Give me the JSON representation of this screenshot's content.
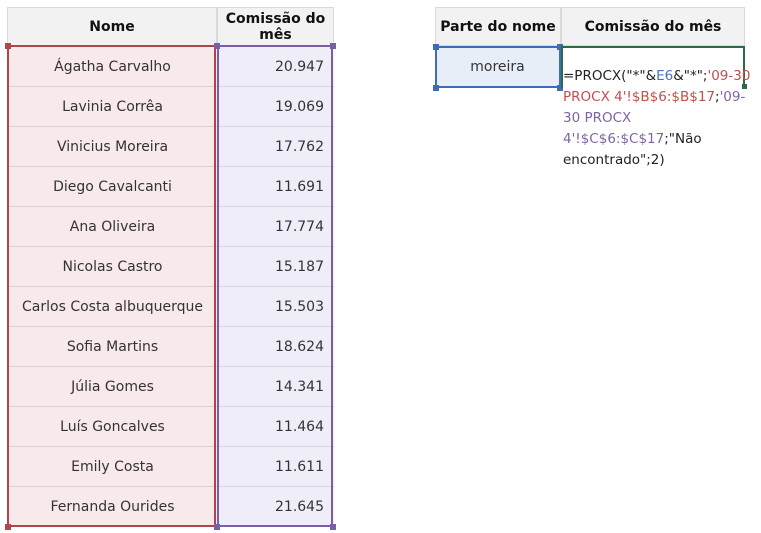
{
  "left_table": {
    "headers": {
      "name": "Nome",
      "commission": "Comissão do mês"
    },
    "rows": [
      {
        "name": "Ágatha Carvalho",
        "value": "20.947"
      },
      {
        "name": "Lavinia Corrêa",
        "value": "19.069"
      },
      {
        "name": "Vinicius Moreira",
        "value": "17.762"
      },
      {
        "name": "Diego Cavalcanti",
        "value": "11.691"
      },
      {
        "name": "Ana Oliveira",
        "value": "17.774"
      },
      {
        "name": "Nicolas Castro",
        "value": "15.187"
      },
      {
        "name": "Carlos Costa albuquerque",
        "value": "15.503"
      },
      {
        "name": "Sofia Martins",
        "value": "18.624"
      },
      {
        "name": "Júlia Gomes",
        "value": "14.341"
      },
      {
        "name": "Luís Goncalves",
        "value": "11.464"
      },
      {
        "name": "Emily Costa",
        "value": "11.611"
      },
      {
        "name": "Fernanda Ourides",
        "value": "21.645"
      }
    ]
  },
  "right_table": {
    "headers": {
      "part": "Parte do nome",
      "commission": "Comissão do mês"
    },
    "part_value": "moreira",
    "formula": {
      "p1": "=PROCX(\"*\"&",
      "p2": "E6",
      "p3": "&\"*\";",
      "p4": "'09-30 PROCX 4'!$B$6:$B$17",
      "p5": ";",
      "p6": "'09-30 PROCX 4'!$C$6:$C$17",
      "p7": ";\"Não encontrado\";2)"
    }
  },
  "colors": {
    "name_range": "#b0464c",
    "value_range": "#7b5ea8",
    "lookup_cell": "#3e6db5",
    "active_cell": "#2e6b45"
  }
}
